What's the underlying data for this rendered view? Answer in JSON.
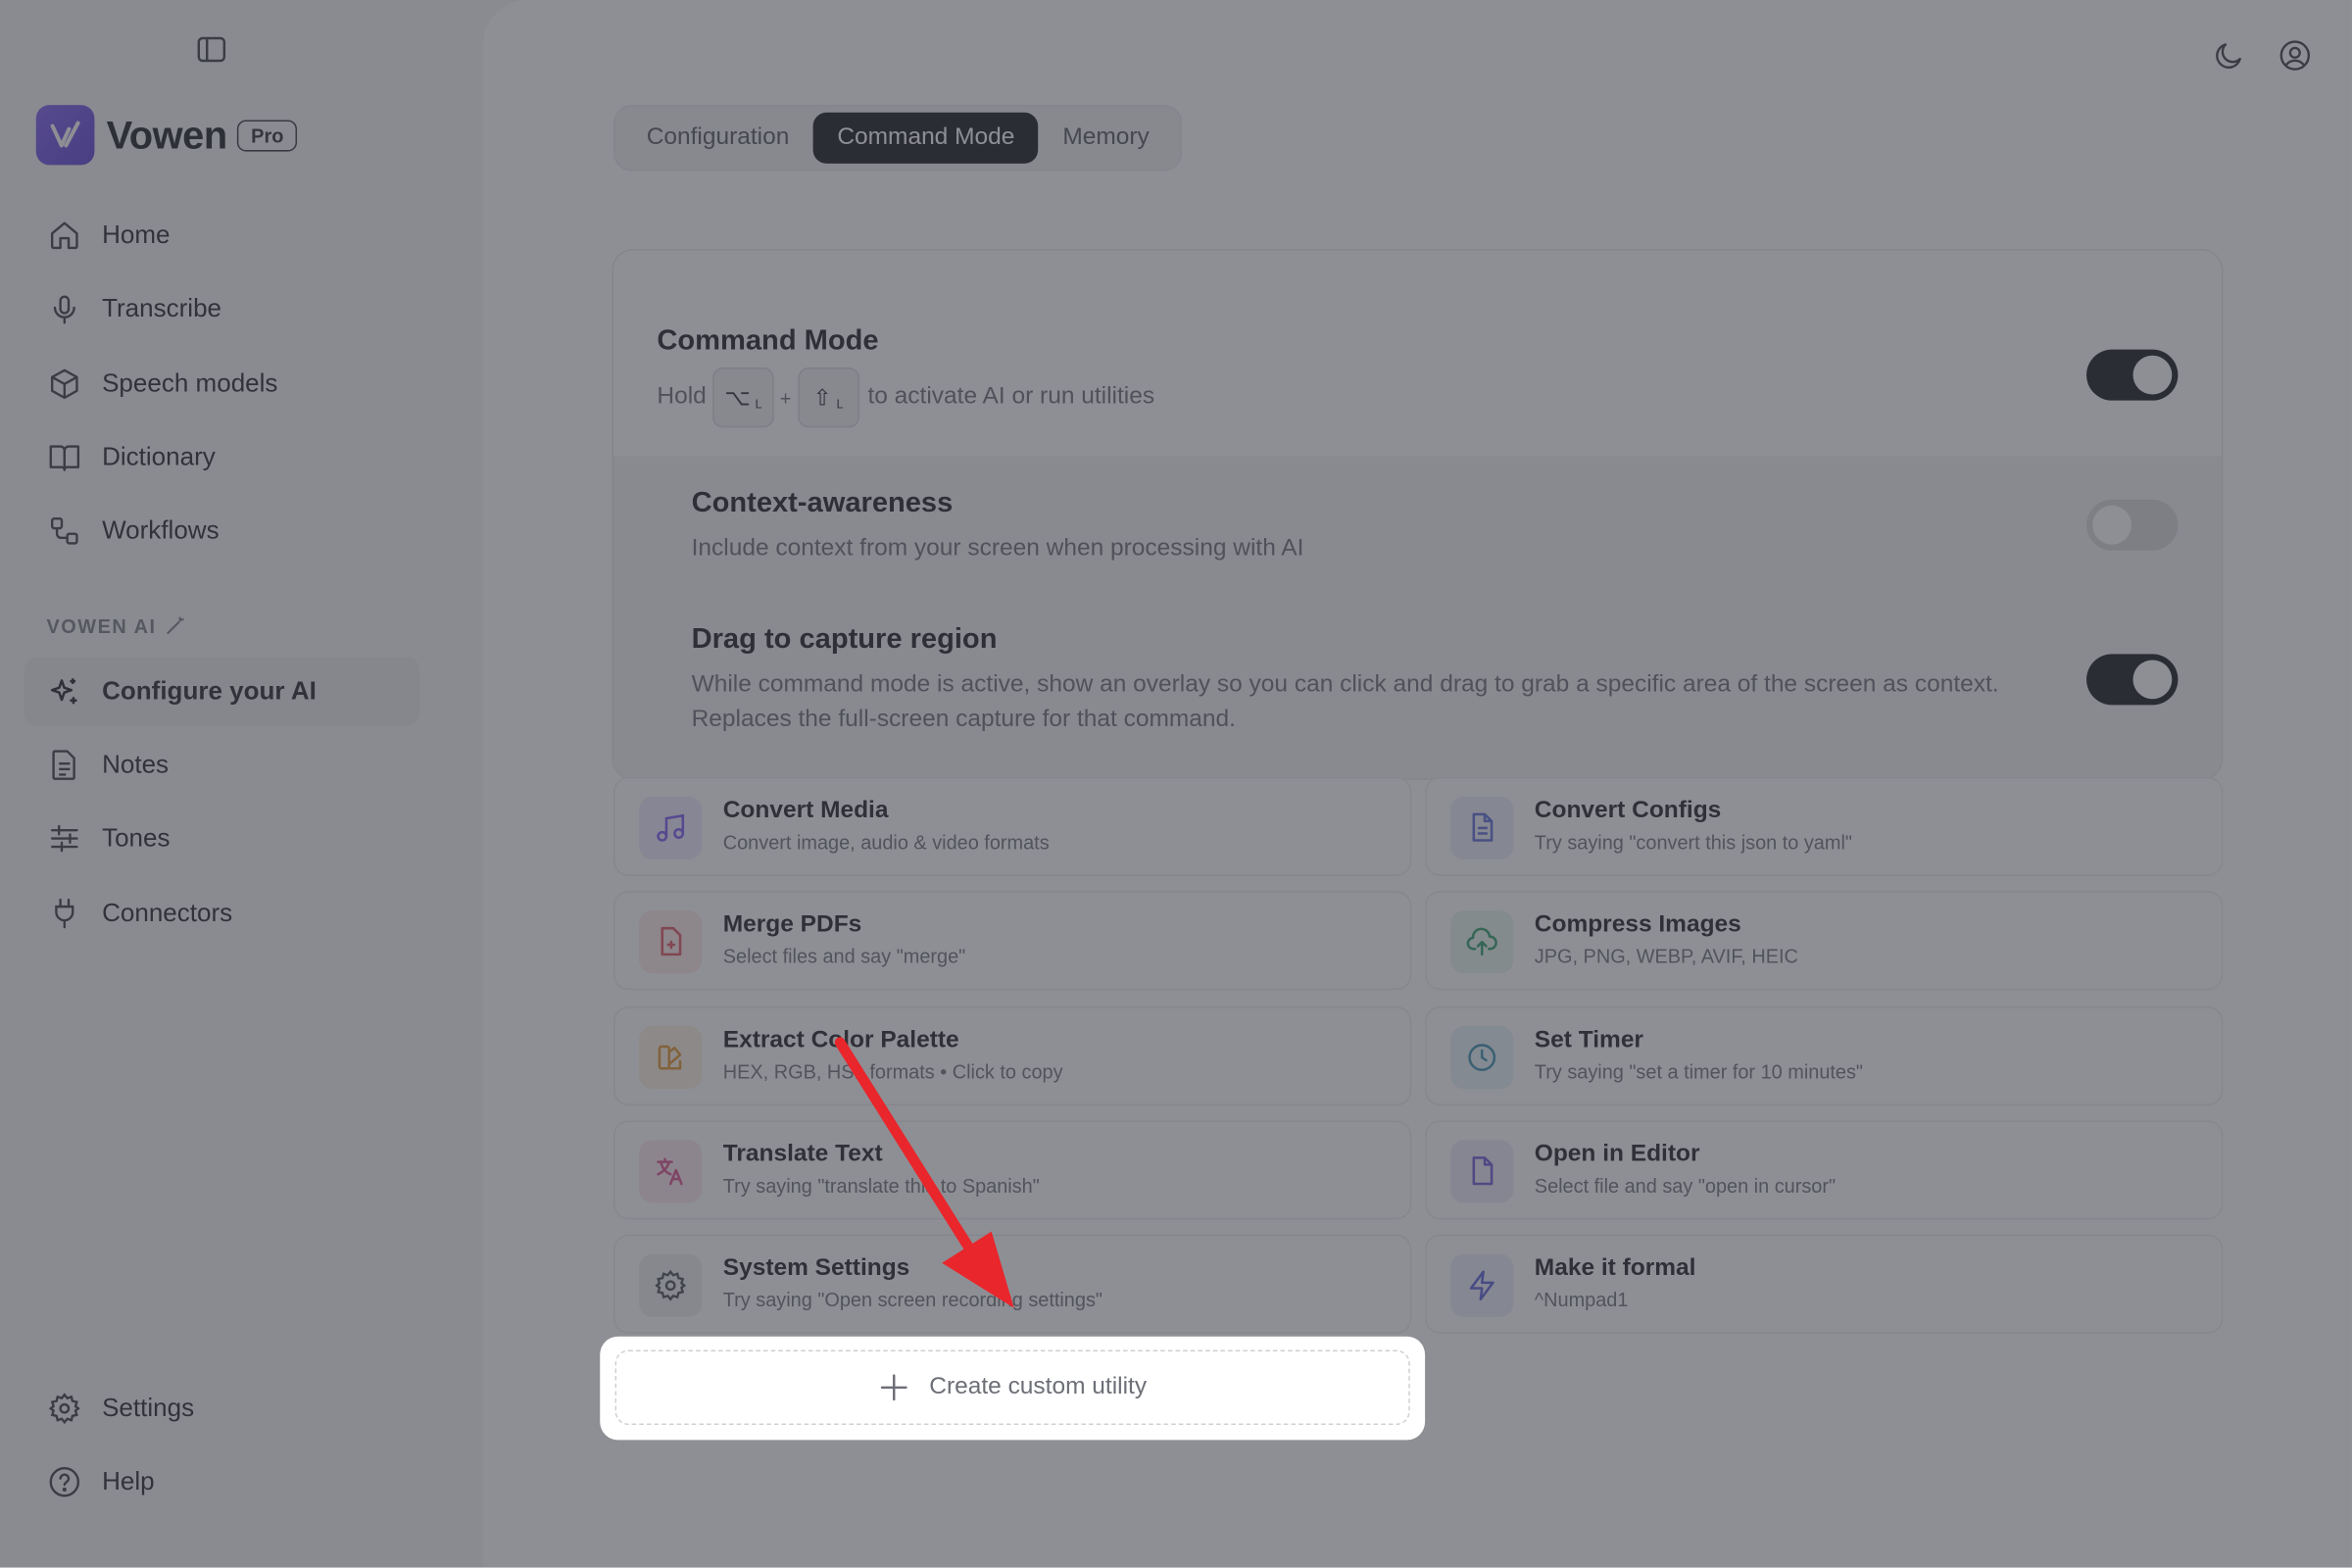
{
  "app": {
    "name": "Vowen",
    "plan_badge": "Pro"
  },
  "sidebar": {
    "items": [
      {
        "label": "Home",
        "icon": "home-icon"
      },
      {
        "label": "Transcribe",
        "icon": "microphone-icon"
      },
      {
        "label": "Speech models",
        "icon": "cube-icon"
      },
      {
        "label": "Dictionary",
        "icon": "book-icon"
      },
      {
        "label": "Workflows",
        "icon": "workflow-icon"
      }
    ],
    "section_label": "VOWEN AI",
    "ai_items": [
      {
        "label": "Configure your AI",
        "icon": "sparkles-icon",
        "active": true
      },
      {
        "label": "Notes",
        "icon": "note-icon"
      },
      {
        "label": "Tones",
        "icon": "sliders-icon"
      },
      {
        "label": "Connectors",
        "icon": "plug-icon"
      }
    ],
    "bottom_items": [
      {
        "label": "Settings",
        "icon": "gear-icon"
      },
      {
        "label": "Help",
        "icon": "help-icon"
      }
    ]
  },
  "tabs": [
    {
      "label": "Configuration",
      "active": false
    },
    {
      "label": "Command Mode",
      "active": true
    },
    {
      "label": "Memory",
      "active": false
    }
  ],
  "command_mode": {
    "title": "Command Mode",
    "hold_prefix": "Hold",
    "key1": "⌥",
    "key1_sub": "L",
    "plus": "+",
    "key2": "⇧",
    "key2_sub": "L",
    "hold_suffix": "to activate AI or run utilities",
    "enabled": true
  },
  "context_awareness": {
    "title": "Context-awareness",
    "description": "Include context from your screen when processing with AI",
    "enabled": false
  },
  "drag_capture": {
    "title": "Drag to capture region",
    "description_line1": "While command mode is active, show an overlay so you can click and drag to grab a specific area of the screen as context.",
    "description_line2": "Replaces the full-screen capture for that command.",
    "enabled": true
  },
  "utilities": [
    {
      "title": "Convert Media",
      "desc": "Convert image, audio & video formats",
      "icon": "music-note-icon",
      "color": "#7a5af5"
    },
    {
      "title": "Convert Configs",
      "desc": "Try saying \"convert this json to yaml\"",
      "icon": "document-icon",
      "color": "#5b6bd6"
    },
    {
      "title": "Merge PDFs",
      "desc": "Select files and say \"merge\"",
      "icon": "file-plus-icon",
      "color": "#e05563"
    },
    {
      "title": "Compress Images",
      "desc": "JPG, PNG, WEBP, AVIF, HEIC",
      "icon": "cloud-upload-icon",
      "color": "#2e9e6a"
    },
    {
      "title": "Extract Color Palette",
      "desc": "HEX, RGB, HSL formats • Click to copy",
      "icon": "palette-icon",
      "color": "#e0952e"
    },
    {
      "title": "Set Timer",
      "desc": "Try saying \"set a timer for 10 minutes\"",
      "icon": "clock-icon",
      "color": "#3c8fb0"
    },
    {
      "title": "Translate Text",
      "desc": "Try saying \"translate this to Spanish\"",
      "icon": "translate-icon",
      "color": "#d94f8c"
    },
    {
      "title": "Open in Editor",
      "desc": "Select file and say \"open in cursor\"",
      "icon": "file-icon",
      "color": "#6a5ad8"
    },
    {
      "title": "System Settings",
      "desc": "Try saying \"Open screen recording settings\"",
      "icon": "gear-icon",
      "color": "#4b4d55"
    },
    {
      "title": "Make it formal",
      "desc": "^Numpad1",
      "icon": "lightning-icon",
      "color": "#5a5fd8"
    }
  ],
  "create_button": {
    "label": "Create custom utility"
  },
  "colors": {
    "accent": "#15171c",
    "overlay_arrow": "#e8262c",
    "brand": "#6b4de6"
  }
}
